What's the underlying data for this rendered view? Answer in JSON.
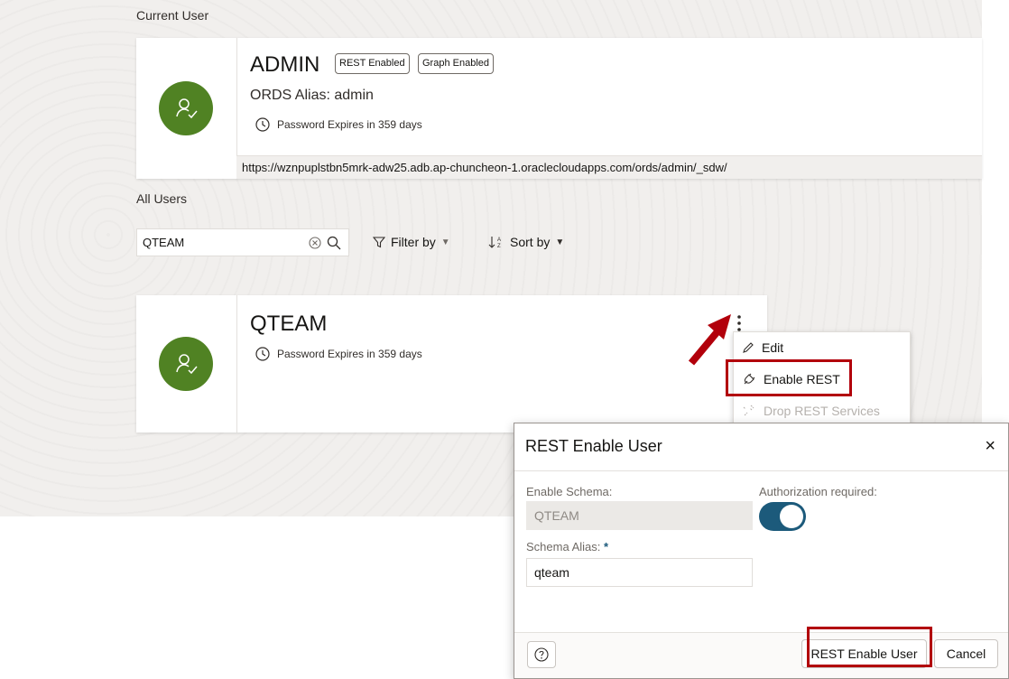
{
  "current_user": {
    "section_title": "Current User",
    "name": "ADMIN",
    "badges": [
      "REST Enabled",
      "Graph Enabled"
    ],
    "alias": "ORDS Alias: admin",
    "password_expiry": "Password Expires in 359 days",
    "url": "https://wznpuplstbn5mrk-adw25.adb.ap-chuncheon-1.oraclecloudapps.com/ords/admin/_sdw/"
  },
  "all_users": {
    "section_title": "All Users",
    "search_value": "QTEAM",
    "filter_label": "Filter by",
    "sort_label": "Sort by"
  },
  "user_card": {
    "name": "QTEAM",
    "password_expiry": "Password Expires in 359 days"
  },
  "context_menu": {
    "items": [
      {
        "label": "Edit",
        "icon": "pencil-icon",
        "enabled": true
      },
      {
        "label": "Enable REST",
        "icon": "plug-icon",
        "enabled": true
      },
      {
        "label": "Drop REST Services",
        "icon": "unplug-icon",
        "enabled": false
      }
    ]
  },
  "dialog": {
    "title": "REST Enable User",
    "close_glyph": "×",
    "enable_schema_label": "Enable Schema:",
    "enable_schema_value": "QTEAM",
    "authorization_label": "Authorization required:",
    "authorization_on": true,
    "schema_alias_label": "Schema Alias:",
    "required_marker": "*",
    "schema_alias_value": "qteam",
    "primary_button": "REST Enable User",
    "cancel_button": "Cancel"
  },
  "colors": {
    "avatar": "#508223",
    "toggle": "#1c5a7b",
    "highlight": "#b2000b"
  }
}
